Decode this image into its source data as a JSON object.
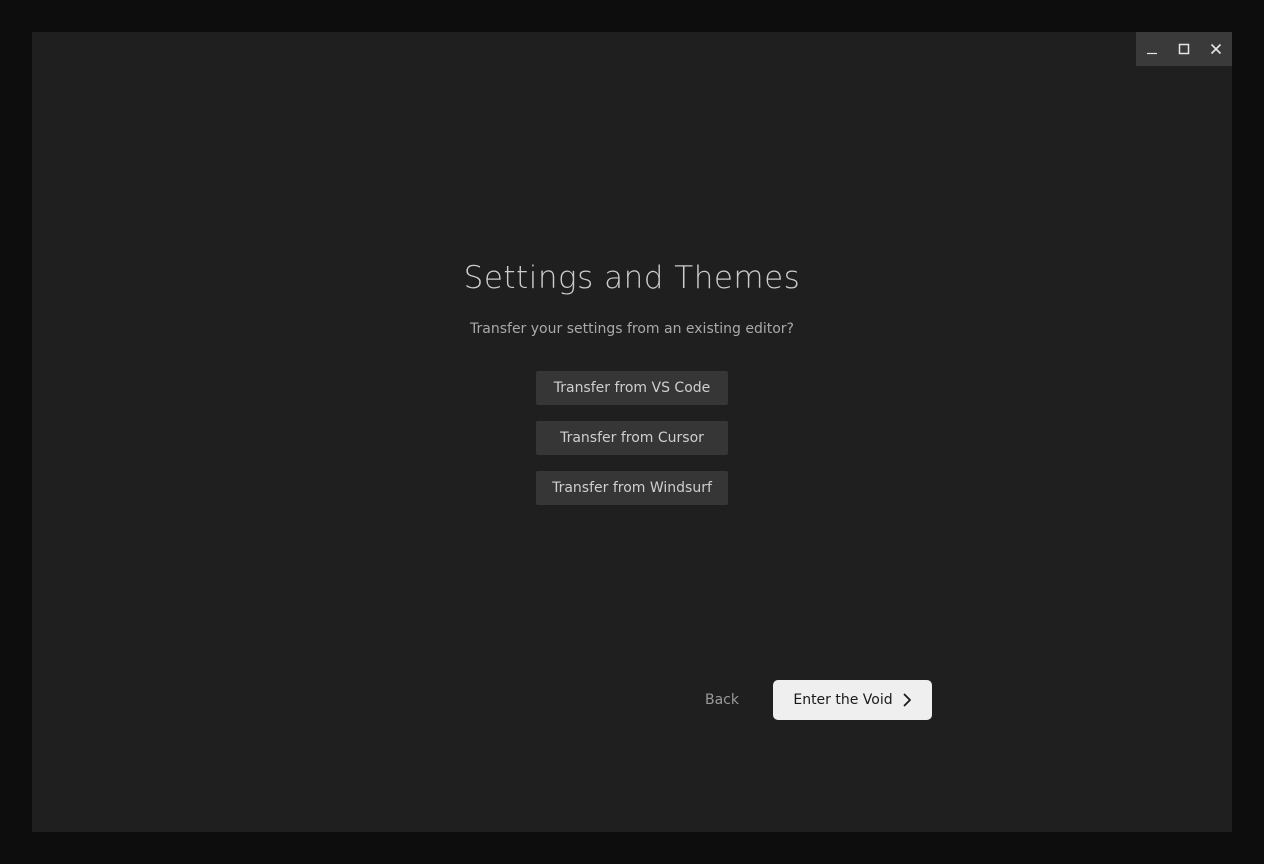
{
  "window": {
    "controls": {
      "minimize_icon": "minimize-icon",
      "maximize_icon": "maximize-icon",
      "close_icon": "close-icon"
    }
  },
  "onboarding": {
    "title": "Settings and Themes",
    "subtitle": "Transfer your settings from an existing editor?",
    "transfer_options": [
      {
        "label": "Transfer from VS Code"
      },
      {
        "label": "Transfer from Cursor"
      },
      {
        "label": "Transfer from Windsurf"
      }
    ],
    "back_label": "Back",
    "enter_label": "Enter the Void",
    "enter_icon": "chevron-right-icon"
  },
  "colors": {
    "background": "#1f1f1f",
    "outer": "#0d0d0d",
    "button": "#363636",
    "primary_button": "#efefef"
  }
}
